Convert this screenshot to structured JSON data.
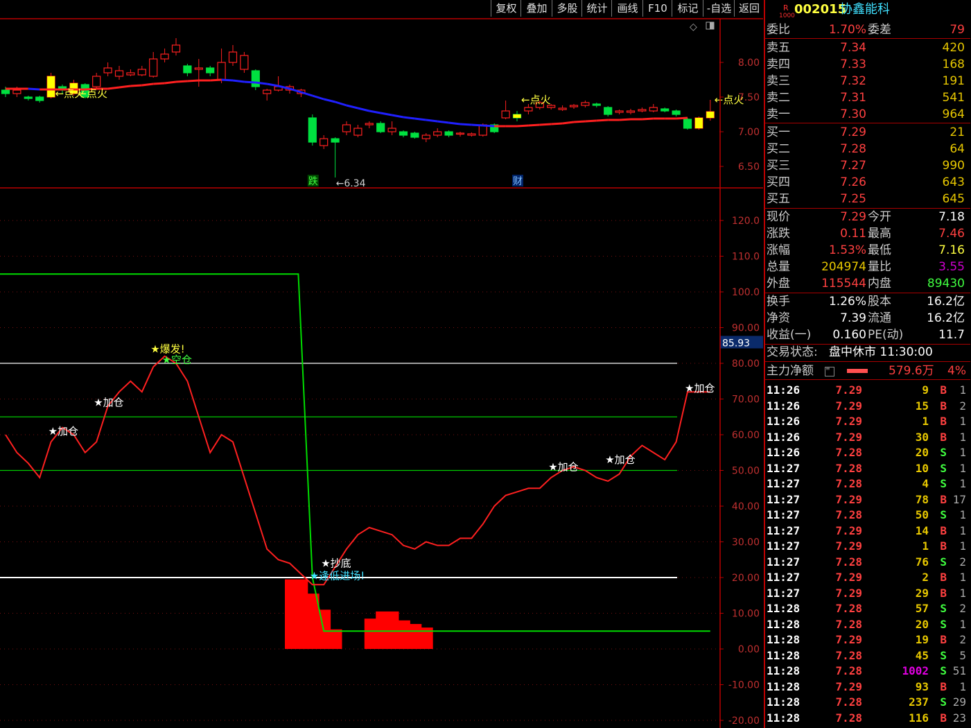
{
  "toolbar": {
    "buttons": [
      "复权",
      "叠加",
      "多股",
      "统计",
      "画线",
      "F10",
      "标记",
      "-自选",
      "返回"
    ]
  },
  "stock": {
    "market_badge": "R",
    "level_badge": "1000",
    "code": "002015",
    "name": "协鑫能科"
  },
  "committee": {
    "ratio_label": "委比",
    "ratio": "1.70%",
    "diff_label": "委差",
    "diff": "79"
  },
  "sell": [
    {
      "label": "卖五",
      "price": "7.34",
      "vol": "420"
    },
    {
      "label": "卖四",
      "price": "7.33",
      "vol": "168"
    },
    {
      "label": "卖三",
      "price": "7.32",
      "vol": "191"
    },
    {
      "label": "卖二",
      "price": "7.31",
      "vol": "541"
    },
    {
      "label": "卖一",
      "price": "7.30",
      "vol": "964"
    }
  ],
  "buy": [
    {
      "label": "买一",
      "price": "7.29",
      "vol": "21"
    },
    {
      "label": "买二",
      "price": "7.28",
      "vol": "64"
    },
    {
      "label": "买三",
      "price": "7.27",
      "vol": "990"
    },
    {
      "label": "买四",
      "price": "7.26",
      "vol": "643"
    },
    {
      "label": "买五",
      "price": "7.25",
      "vol": "645"
    }
  ],
  "quote": [
    {
      "l1": "现价",
      "v1": "7.29",
      "c1": "#ff4040",
      "l2": "今开",
      "v2": "7.18",
      "c2": "#ffffff"
    },
    {
      "l1": "涨跌",
      "v1": "0.11",
      "c1": "#ff4040",
      "l2": "最高",
      "v2": "7.46",
      "c2": "#ff4040"
    },
    {
      "l1": "涨幅",
      "v1": "1.53%",
      "c1": "#ff4040",
      "l2": "最低",
      "v2": "7.16",
      "c2": "#ffff40"
    },
    {
      "l1": "总量",
      "v1": "204974",
      "c1": "#e8c800",
      "l2": "量比",
      "v2": "3.55",
      "c2": "#d000d0"
    },
    {
      "l1": "外盘",
      "v1": "115544",
      "c1": "#ff4040",
      "l2": "内盘",
      "v2": "89430",
      "c2": "#40ff40"
    }
  ],
  "fundamentals": [
    {
      "l1": "换手",
      "v1": "1.26%",
      "l2": "股本",
      "v2": "16.2亿"
    },
    {
      "l1": "净资",
      "v1": "7.39",
      "l2": "流通",
      "v2": "16.2亿"
    },
    {
      "l1": "收益(一)",
      "v1": "0.160",
      "l2": "PE(动)",
      "v2": "11.7"
    }
  ],
  "status": {
    "label": "交易状态:",
    "value": "盘中休市 11:30:00"
  },
  "main_force": {
    "label": "主力净额",
    "value": "579.6万",
    "pct": "4%"
  },
  "ticks": [
    {
      "t": "11:26",
      "p": "7.29",
      "v": "9",
      "s": "B",
      "n": "1"
    },
    {
      "t": "11:26",
      "p": "7.29",
      "v": "15",
      "s": "B",
      "n": "2"
    },
    {
      "t": "11:26",
      "p": "7.29",
      "v": "1",
      "s": "B",
      "n": "1"
    },
    {
      "t": "11:26",
      "p": "7.29",
      "v": "30",
      "s": "B",
      "n": "1"
    },
    {
      "t": "11:26",
      "p": "7.28",
      "v": "20",
      "s": "S",
      "n": "1"
    },
    {
      "t": "11:27",
      "p": "7.28",
      "v": "10",
      "s": "S",
      "n": "1"
    },
    {
      "t": "11:27",
      "p": "7.28",
      "v": "4",
      "s": "S",
      "n": "1"
    },
    {
      "t": "11:27",
      "p": "7.29",
      "v": "78",
      "s": "B",
      "n": "17"
    },
    {
      "t": "11:27",
      "p": "7.28",
      "v": "50",
      "s": "S",
      "n": "1"
    },
    {
      "t": "11:27",
      "p": "7.29",
      "v": "14",
      "s": "B",
      "n": "1"
    },
    {
      "t": "11:27",
      "p": "7.29",
      "v": "1",
      "s": "B",
      "n": "1"
    },
    {
      "t": "11:27",
      "p": "7.28",
      "v": "76",
      "s": "S",
      "n": "2"
    },
    {
      "t": "11:27",
      "p": "7.29",
      "v": "2",
      "s": "B",
      "n": "1"
    },
    {
      "t": "11:27",
      "p": "7.29",
      "v": "29",
      "s": "B",
      "n": "1"
    },
    {
      "t": "11:28",
      "p": "7.28",
      "v": "57",
      "s": "S",
      "n": "2"
    },
    {
      "t": "11:28",
      "p": "7.28",
      "v": "20",
      "s": "S",
      "n": "1"
    },
    {
      "t": "11:28",
      "p": "7.29",
      "v": "19",
      "s": "B",
      "n": "2"
    },
    {
      "t": "11:28",
      "p": "7.28",
      "v": "45",
      "s": "S",
      "n": "5"
    },
    {
      "t": "11:28",
      "p": "7.28",
      "v": "1002",
      "s": "S",
      "n": "51"
    },
    {
      "t": "11:28",
      "p": "7.29",
      "v": "93",
      "s": "B",
      "n": "1"
    },
    {
      "t": "11:28",
      "p": "7.28",
      "v": "237",
      "s": "S",
      "n": "29"
    },
    {
      "t": "11:28",
      "p": "7.28",
      "v": "116",
      "s": "B",
      "n": "23"
    }
  ],
  "chart_data": [
    {
      "type": "candlestick",
      "y_ticks": [
        "8.00",
        "7.50",
        "7.00",
        "6.50"
      ],
      "ylim": [
        6.2,
        8.6
      ],
      "ma_color_up": "#ff2020",
      "ma_color_down": "#2020ff",
      "ma": [
        7.62,
        7.62,
        7.62,
        7.61,
        7.61,
        7.61,
        7.61,
        7.61,
        7.62,
        7.62,
        7.64,
        7.66,
        7.67,
        7.69,
        7.7,
        7.72,
        7.73,
        7.74,
        7.74,
        7.75,
        7.74,
        7.72,
        7.71,
        7.69,
        7.66,
        7.62,
        7.57,
        7.52,
        7.47,
        7.43,
        7.38,
        7.34,
        7.3,
        7.27,
        7.24,
        7.21,
        7.19,
        7.17,
        7.15,
        7.13,
        7.11,
        7.1,
        7.09,
        7.08,
        7.08,
        7.08,
        7.09,
        7.1,
        7.11,
        7.12,
        7.14,
        7.15,
        7.16,
        7.17,
        7.17,
        7.18,
        7.18,
        7.19,
        7.19,
        7.19,
        7.2
      ],
      "candles": [
        [
          7.6,
          7.55,
          7.65,
          7.5
        ],
        [
          7.55,
          7.6,
          7.65,
          7.5
        ],
        [
          7.5,
          7.48,
          7.52,
          7.45
        ],
        [
          7.5,
          7.45,
          7.52,
          7.42
        ],
        [
          7.5,
          7.8,
          7.85,
          7.48
        ],
        [
          7.65,
          7.6,
          7.68,
          7.55
        ],
        [
          7.55,
          7.7,
          7.75,
          7.52
        ],
        [
          7.68,
          7.5,
          7.7,
          7.48
        ],
        [
          7.65,
          7.8,
          7.85,
          7.62
        ],
        [
          7.85,
          7.92,
          8.0,
          7.8
        ],
        [
          7.8,
          7.88,
          7.95,
          7.75
        ],
        [
          7.82,
          7.85,
          7.9,
          7.8
        ],
        [
          7.82,
          7.9,
          7.95,
          7.8
        ],
        [
          7.8,
          8.05,
          8.15,
          7.78
        ],
        [
          8.05,
          8.12,
          8.2,
          8.0
        ],
        [
          8.15,
          8.25,
          8.35,
          8.1
        ],
        [
          7.95,
          7.85,
          7.98,
          7.8
        ],
        [
          7.9,
          7.92,
          8.05,
          7.65
        ],
        [
          7.92,
          7.85,
          7.95,
          7.8
        ],
        [
          7.75,
          8.0,
          8.2,
          7.7
        ],
        [
          8.0,
          8.15,
          8.25,
          7.95
        ],
        [
          7.9,
          8.1,
          8.15,
          7.85
        ],
        [
          7.88,
          7.65,
          7.9,
          7.6
        ],
        [
          7.55,
          7.6,
          7.62,
          7.45
        ],
        [
          7.6,
          7.65,
          7.8,
          7.58
        ],
        [
          7.6,
          7.65,
          7.68,
          7.55
        ],
        [
          7.55,
          7.6,
          7.62,
          7.5
        ],
        [
          7.2,
          6.85,
          7.25,
          6.8
        ],
        [
          6.8,
          6.9,
          6.95,
          6.75
        ],
        [
          6.9,
          6.85,
          6.92,
          6.34
        ],
        [
          7.0,
          7.1,
          7.15,
          6.95
        ],
        [
          6.95,
          7.05,
          7.1,
          6.92
        ],
        [
          7.1,
          7.12,
          7.15,
          7.05
        ],
        [
          7.12,
          7.0,
          7.15,
          6.98
        ],
        [
          7.0,
          7.05,
          7.15,
          6.95
        ],
        [
          7.0,
          6.95,
          7.02,
          6.92
        ],
        [
          6.98,
          6.92,
          7.0,
          6.9
        ],
        [
          6.9,
          6.95,
          6.98,
          6.85
        ],
        [
          6.95,
          7.0,
          7.05,
          6.92
        ],
        [
          7.0,
          6.95,
          7.02,
          6.92
        ],
        [
          6.97,
          6.98,
          7.0,
          6.93
        ],
        [
          6.95,
          6.97,
          6.99,
          6.93
        ],
        [
          6.95,
          7.1,
          7.12,
          6.93
        ],
        [
          7.1,
          7.0,
          7.12,
          6.98
        ],
        [
          7.2,
          7.3,
          7.45,
          7.18
        ],
        [
          7.25,
          7.2,
          7.3,
          7.15
        ],
        [
          7.3,
          7.35,
          7.4,
          7.25
        ],
        [
          7.35,
          7.42,
          7.45,
          7.32
        ],
        [
          7.35,
          7.38,
          7.4,
          7.32
        ],
        [
          7.32,
          7.34,
          7.38,
          7.3
        ],
        [
          7.36,
          7.38,
          7.4,
          7.33
        ],
        [
          7.38,
          7.42,
          7.45,
          7.35
        ],
        [
          7.4,
          7.38,
          7.42,
          7.35
        ],
        [
          7.35,
          7.25,
          7.37,
          7.22
        ],
        [
          7.28,
          7.3,
          7.32,
          7.25
        ],
        [
          7.28,
          7.3,
          7.33,
          7.25
        ],
        [
          7.3,
          7.32,
          7.35,
          7.28
        ],
        [
          7.3,
          7.35,
          7.4,
          7.28
        ],
        [
          7.33,
          7.3,
          7.35,
          7.28
        ],
        [
          7.3,
          7.25,
          7.32,
          7.22
        ],
        [
          7.18,
          7.05,
          7.2,
          7.03
        ],
        [
          7.05,
          7.2,
          7.22,
          7.03
        ],
        [
          7.2,
          7.29,
          7.46,
          7.16
        ]
      ],
      "signals": [
        {
          "i": 4,
          "text": "←点火"
        },
        {
          "i": 6,
          "text": "←点火"
        },
        {
          "i": 45,
          "text": "←点火"
        },
        {
          "i": 62,
          "text": "←点火"
        }
      ],
      "low_label": "←6.34",
      "markers": [
        {
          "i": 27,
          "text": "跌"
        },
        {
          "i": 45,
          "text": "财"
        }
      ]
    },
    {
      "type": "line",
      "current_value": "85.93",
      "y_ticks": [
        "120.0",
        "110.0",
        "100.0",
        "90.00",
        "80.00",
        "70.00",
        "60.00",
        "50.00",
        "40.00",
        "30.00",
        "20.00",
        "10.00",
        "0.00",
        "-10.00",
        "-20.00"
      ],
      "ylim": [
        -20,
        120
      ],
      "hlines": [
        {
          "y": 80,
          "color": "#ffffff"
        },
        {
          "y": 65,
          "color": "#00cc00"
        },
        {
          "y": 50,
          "color": "#00cc00"
        },
        {
          "y": 20,
          "color": "#ffffff"
        }
      ],
      "curve_x": [
        0,
        1,
        2,
        3,
        4,
        5,
        6,
        7,
        8,
        9,
        10,
        11,
        12,
        13,
        14,
        15,
        16,
        17,
        18,
        19,
        20,
        21,
        22,
        23,
        24,
        25,
        26,
        27,
        28,
        29,
        30,
        31,
        32,
        33,
        34,
        35,
        36,
        37,
        38,
        39,
        40,
        41,
        42,
        43,
        44,
        45,
        46,
        47,
        48,
        49,
        50,
        51,
        52,
        53,
        54,
        55,
        56,
        57,
        58,
        59,
        60,
        61,
        62
      ],
      "curve_y": [
        60,
        55,
        52,
        48,
        58,
        62,
        60,
        55,
        58,
        68,
        72,
        75,
        72,
        79,
        82,
        80,
        75,
        65,
        55,
        60,
        58,
        48,
        38,
        28,
        25,
        24,
        21,
        18,
        18,
        23,
        28,
        32,
        34,
        33,
        32,
        29,
        28,
        30,
        29,
        29,
        31,
        31,
        35,
        40,
        43,
        44,
        45,
        45,
        48,
        50,
        51,
        50,
        48,
        47,
        49,
        54,
        57,
        55,
        53,
        58,
        72,
        72,
        72
      ],
      "curve_color": "#ff2020",
      "step_x": [
        0,
        26,
        27,
        28,
        62
      ],
      "step_y": [
        105,
        105,
        20,
        5,
        5
      ],
      "step_color": "#00dd00",
      "bars": [
        [
          25,
          19.5
        ],
        [
          26,
          19.5
        ],
        [
          27,
          15.5
        ],
        [
          28,
          11
        ],
        [
          29,
          5.5
        ],
        [
          32,
          8.5
        ],
        [
          33,
          10.5
        ],
        [
          34,
          10.5
        ],
        [
          35,
          8
        ],
        [
          36,
          7
        ],
        [
          37,
          6
        ]
      ],
      "labels": [
        {
          "i": 4,
          "y": 61,
          "text": "★加仓",
          "color": "#ffffff"
        },
        {
          "i": 8,
          "y": 69,
          "text": "★加仓",
          "color": "#ffffff"
        },
        {
          "i": 13,
          "y": 84,
          "text": "★爆发!",
          "color": "#ffff40"
        },
        {
          "i": 14,
          "y": 81,
          "text": "★空仓",
          "color": "#40ff40"
        },
        {
          "i": 28,
          "y": 24,
          "text": "★抄底",
          "color": "#ffffff"
        },
        {
          "i": 27,
          "y": 20.5,
          "text": "★逢低进场!",
          "color": "#40e0ff"
        },
        {
          "i": 48,
          "y": 51,
          "text": "★加仓",
          "color": "#ffffff"
        },
        {
          "i": 53,
          "y": 53,
          "text": "★加仓",
          "color": "#ffffff"
        },
        {
          "i": 60,
          "y": 73,
          "text": "★加仓",
          "color": "#ffffff"
        }
      ]
    }
  ]
}
